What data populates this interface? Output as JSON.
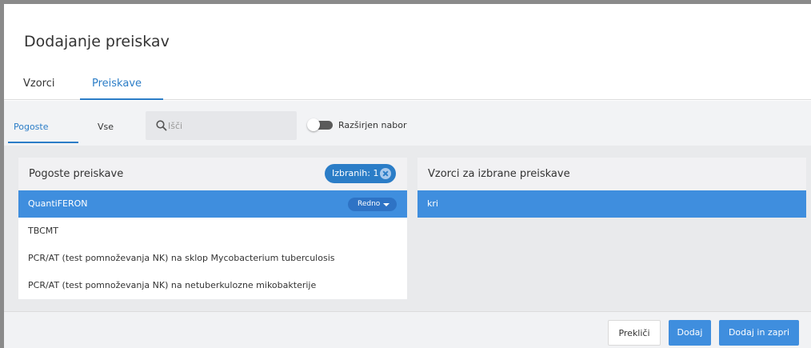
{
  "dialog": {
    "title": "Dodajanje preiskav"
  },
  "main_tabs": [
    {
      "label": "Vzorci",
      "active": false
    },
    {
      "label": "Preiskave",
      "active": true
    }
  ],
  "sub_tabs": [
    {
      "label": "Pogoste",
      "active": true
    },
    {
      "label": "Vse",
      "active": false
    }
  ],
  "search": {
    "placeholder": "Išči",
    "value": ""
  },
  "toggle": {
    "label": "Razširjen nabor",
    "on": false
  },
  "left_panel": {
    "title": "Pogoste preiskave",
    "badge_label": "Izbranih: 1",
    "items": [
      {
        "label": "QuantiFERON",
        "selected": true,
        "priority": "Redno"
      },
      {
        "label": "TBCMT",
        "selected": false
      },
      {
        "label": "PCR/AT (test pomnoževanja NK) na sklop Mycobacterium tuberculosis",
        "selected": false
      },
      {
        "label": "PCR/AT (test pomnoževanja NK) na netuberkulozne mikobakterije",
        "selected": false
      }
    ]
  },
  "right_panel": {
    "title": "Vzorci za izbrane preiskave",
    "items": [
      {
        "label": "kri",
        "selected": true
      }
    ]
  },
  "footer": {
    "cancel_label": "Prekliči",
    "add_label": "Dodaj",
    "add_close_label": "Dodaj in zapri"
  },
  "colors": {
    "accent": "#2b7dc7",
    "selected_row": "#3f8ede",
    "toggle_track": "#5a5a5a"
  }
}
